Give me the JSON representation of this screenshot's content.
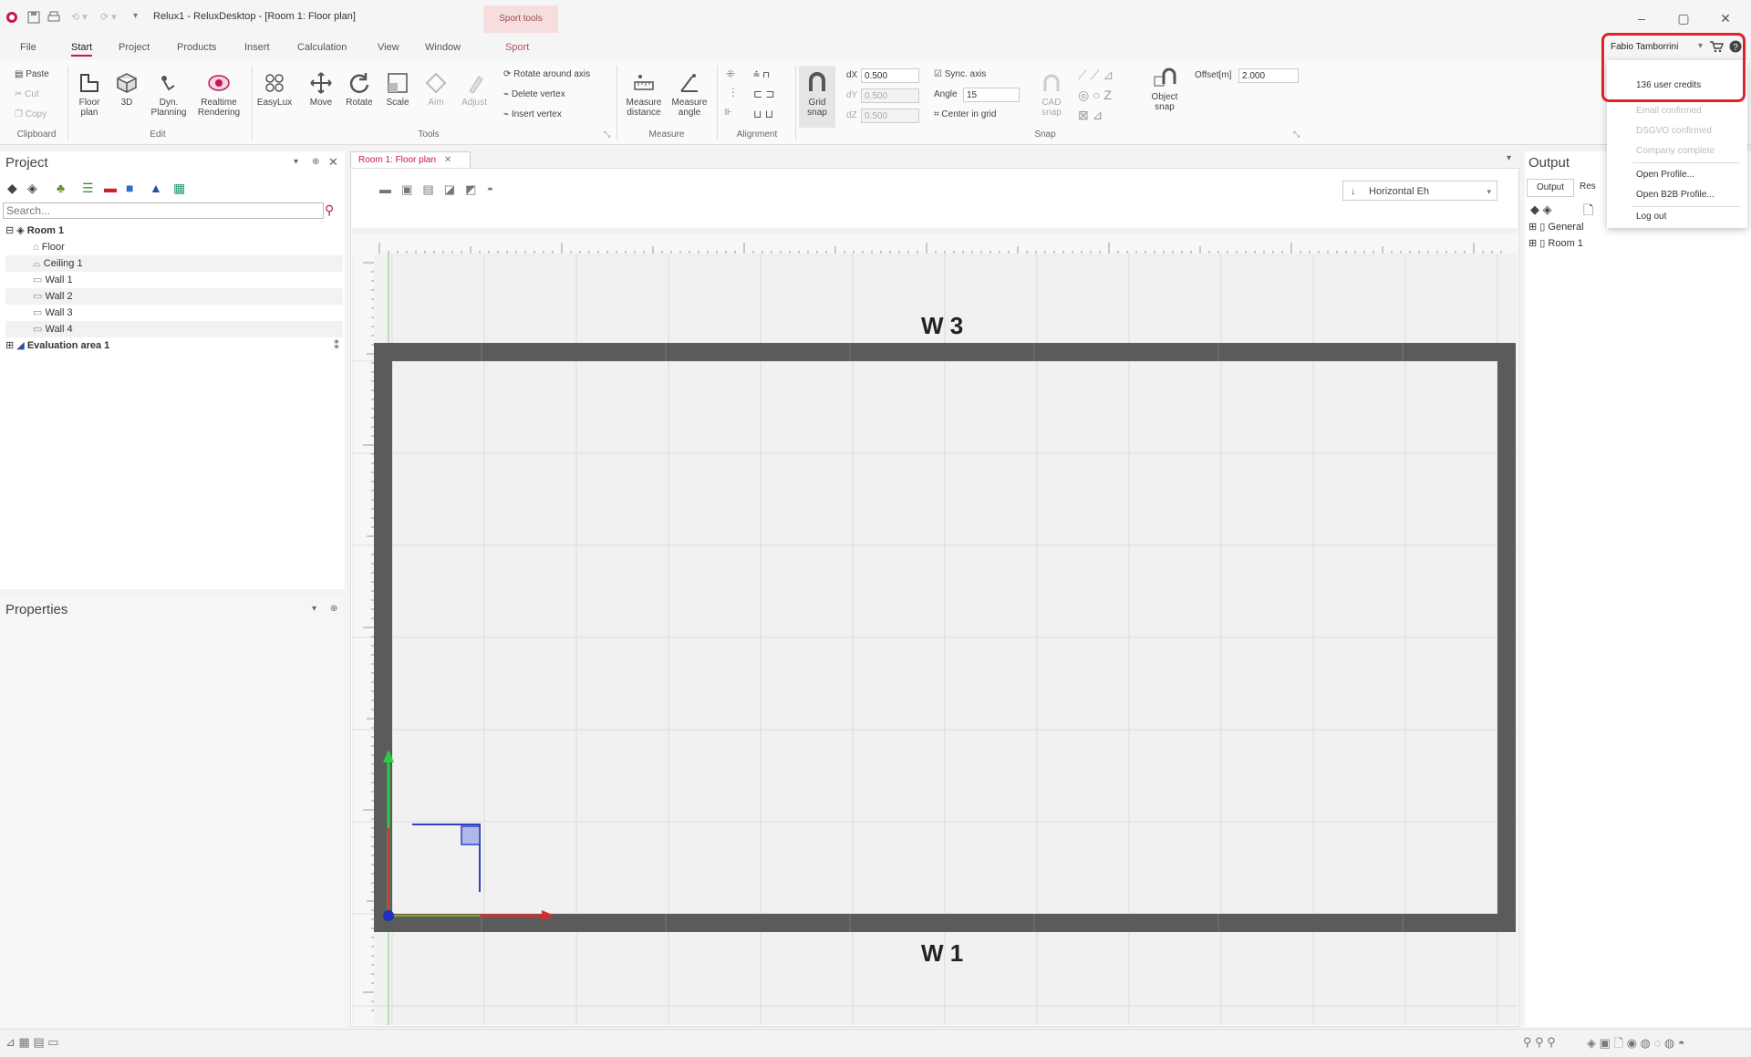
{
  "window": {
    "title": "Relux1 - ReluxDesktop - [Room 1: Floor plan]",
    "context_tab": "Sport tools"
  },
  "menu": {
    "tabs": [
      "File",
      "Start",
      "Project",
      "Products",
      "Insert",
      "Calculation",
      "View",
      "Window",
      "Sport"
    ],
    "active": "Start"
  },
  "user": {
    "name": "Fabio Tamborrini"
  },
  "user_menu": {
    "items": [
      "136 user credits",
      "Email confirmed",
      "DSGVO confirmed",
      "Company complete",
      "Open Profile...",
      "Open B2B Profile...",
      "Log out"
    ]
  },
  "ribbon": {
    "clipboard": {
      "paste": "Paste",
      "cut": "Cut",
      "copy": "Copy",
      "label": "Clipboard"
    },
    "edit": {
      "floor_plan": "Floor plan",
      "three_d": "3D",
      "dyn_planning": "Dyn. Planning",
      "realtime_rendering": "Realtime Rendering",
      "label": "Edit"
    },
    "tools": {
      "easylux": "EasyLux",
      "move": "Move",
      "rotate": "Rotate",
      "scale": "Scale",
      "aim": "Aim",
      "adjust": "Adjust",
      "rotate_around_axis": "Rotate around axis",
      "delete_vertex": "Delete vertex",
      "insert_vertex": "Insert vertex",
      "label": "Tools"
    },
    "measure": {
      "measure_distance": "Measure distance",
      "measure_angle": "Measure angle",
      "label": "Measure"
    },
    "alignment": {
      "label": "Alignment"
    },
    "snap": {
      "grid_snap": "Grid snap",
      "dx_label": "dX",
      "dx_value": "0.500",
      "dy_label": "dY",
      "dy_value": "0.500",
      "dz_label": "dZ",
      "dz_value": "0.500",
      "sync_axis": "Sync. axis",
      "angle_label": "Angle",
      "angle_value": "15",
      "center_in_grid": "Center in grid",
      "cad_snap": "CAD snap",
      "object_snap": "Object snap",
      "offset_label": "Offset[m]",
      "offset_value": "2.000",
      "label": "Snap"
    }
  },
  "project_panel": {
    "title": "Project",
    "search_placeholder": "Search...",
    "tree": [
      {
        "label": "Room 1",
        "level": 0
      },
      {
        "label": "Floor",
        "level": 1
      },
      {
        "label": "Ceiling 1",
        "level": 1
      },
      {
        "label": "Wall 1",
        "level": 1
      },
      {
        "label": "Wall 2",
        "level": 1
      },
      {
        "label": "Wall 3",
        "level": 1
      },
      {
        "label": "Wall 4",
        "level": 1
      },
      {
        "label": "Evaluation area 1",
        "level": 0
      }
    ]
  },
  "properties_panel": {
    "title": "Properties"
  },
  "document": {
    "tab_label": "Room 1: Floor plan",
    "view_select": "Horizontal Eh",
    "wall_top": "W 3",
    "wall_bottom": "W 1"
  },
  "output_panel": {
    "title": "Output",
    "tabs": [
      "Output",
      "Res"
    ],
    "tree": [
      "General",
      "Room 1"
    ]
  }
}
